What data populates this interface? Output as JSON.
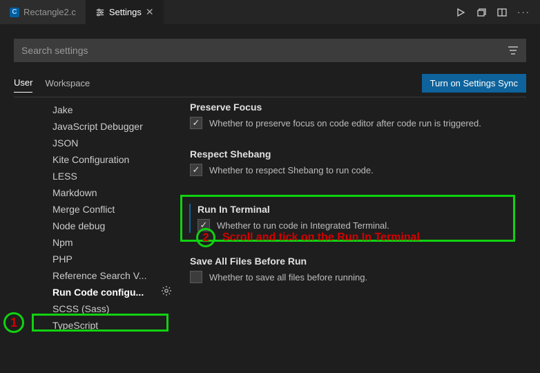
{
  "tabs": {
    "file": {
      "icon_letter": "C",
      "label": "Rectangle2.c"
    },
    "settings": {
      "label": "Settings"
    }
  },
  "search": {
    "placeholder": "Search settings"
  },
  "scopes": {
    "user": "User",
    "workspace": "Workspace"
  },
  "sync_button": "Turn on Settings Sync",
  "sidebar": {
    "items": [
      "Jake",
      "JavaScript Debugger",
      "JSON",
      "Kite Configuration",
      "LESS",
      "Markdown",
      "Merge Conflict",
      "Node debug",
      "Npm",
      "PHP",
      "Reference Search V...",
      "Run Code configu...",
      "SCSS (Sass)",
      "TypeScript"
    ]
  },
  "settings": {
    "preserve_focus": {
      "title": "Preserve Focus",
      "desc": "Whether to preserve focus on code editor after code run is triggered.",
      "checked": true
    },
    "respect_shebang": {
      "title": "Respect Shebang",
      "desc": "Whether to respect Shebang to run code.",
      "checked": true
    },
    "run_in_terminal": {
      "title": "Run In Terminal",
      "desc": "Whether to run code in Integrated Terminal.",
      "checked": true
    },
    "save_all": {
      "title": "Save All Files Before Run",
      "desc": "Whether to save all files before running.",
      "checked": false
    }
  },
  "annotations": {
    "one": "1",
    "two": "2",
    "two_text": "Scroll and tick on the Run In Terminal"
  }
}
